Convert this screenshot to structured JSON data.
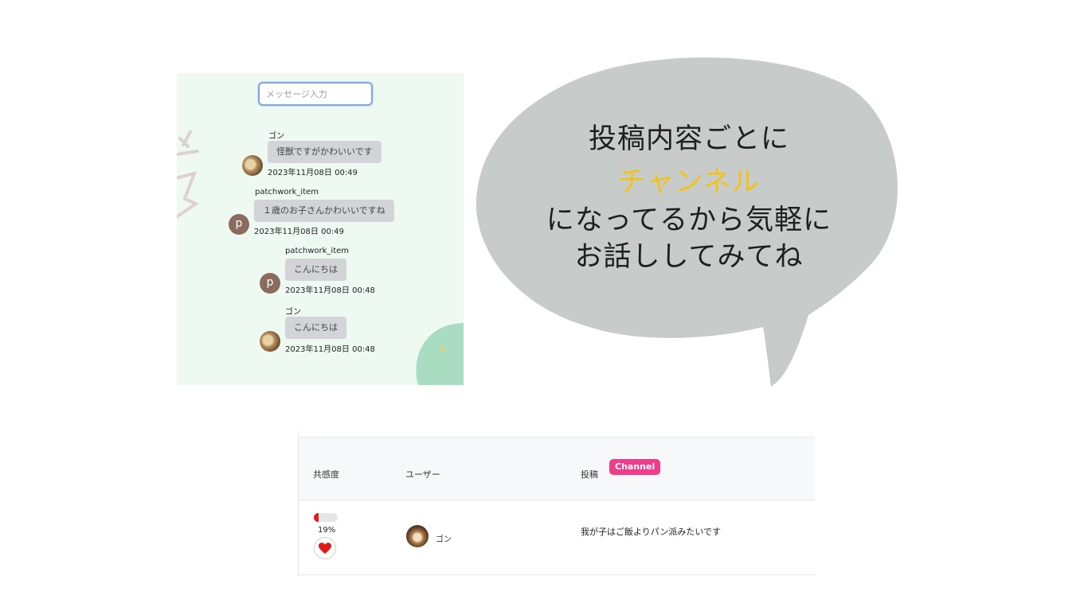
{
  "chat": {
    "input_placeholder": "メッセージ入力",
    "messages": [
      {
        "name": "ゴン",
        "text": "怪獣ですがかわいいです",
        "time": "2023年11月08日 00:49",
        "avatar": "photo"
      },
      {
        "name": "patchwork_item",
        "text": "１歳のお子さんかわいいですね",
        "time": "2023年11月08日 00:49",
        "avatar": "p"
      },
      {
        "name": "patchwork_item",
        "text": "こんにちは",
        "time": "2023年11月08日 00:48",
        "avatar": "p"
      },
      {
        "name": "ゴン",
        "text": "こんにちは",
        "time": "2023年11月08日 00:48",
        "avatar": "photo"
      }
    ]
  },
  "speech": {
    "line1": "投稿内容ごとに",
    "line2": "チャンネル",
    "line3": "になってるから気軽に",
    "line4": "お話ししてみてね",
    "bubble_color": "#c7cccb",
    "accent_color": "#f2c21b"
  },
  "table": {
    "headers": {
      "empathy": "共感度",
      "user": "ユーザー",
      "post": "投稿"
    },
    "channel_badge": "Channel",
    "channel_color": "#ef3d8c",
    "row": {
      "progress_fraction": 0.19,
      "percent": "19%",
      "user": "ゴン",
      "post": "我が子はご飯よりパン派みたいです"
    }
  },
  "icons": {
    "like": "heart-icon",
    "avatar": "user-avatar"
  }
}
